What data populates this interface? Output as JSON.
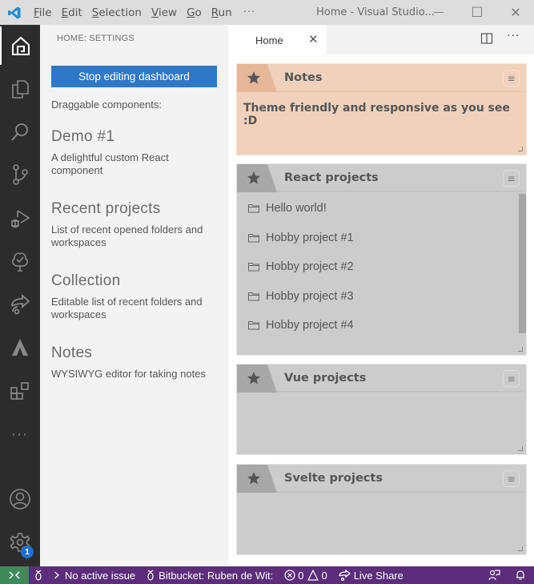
{
  "titlebar": {
    "menu": [
      {
        "accel": "F",
        "rest": "ile"
      },
      {
        "accel": "E",
        "rest": "dit"
      },
      {
        "accel": "S",
        "rest": "election"
      },
      {
        "accel": "V",
        "rest": "iew"
      },
      {
        "accel": "G",
        "rest": "o"
      },
      {
        "accel": "R",
        "rest": "un"
      }
    ],
    "more": "···",
    "window_title": "Home - Visual Studio...",
    "controls": {
      "minimize": "—",
      "maximize": "☐",
      "close": "✕"
    }
  },
  "activitybar": {
    "items": [
      "home-icon",
      "explorer-icon",
      "search-icon",
      "source-control-icon",
      "run-debug-icon",
      "tree-icon",
      "live-share-icon",
      "atlassian-icon",
      "extensions-icon",
      "more-icon",
      "account-icon",
      "settings-gear-icon"
    ],
    "more_label": "···",
    "settings_badge": "1"
  },
  "sidebar": {
    "title": "HOME: SETTINGS",
    "stop_button": "Stop editing dashboard",
    "draggable_label": "Draggable components:",
    "components": [
      {
        "title": "Demo #1",
        "description": "A delightful custom React component"
      },
      {
        "title": "Recent projects",
        "description": "List of recent opened folders and workspaces"
      },
      {
        "title": "Collection",
        "description": "Editable list of recent folders and workspaces"
      },
      {
        "title": "Notes",
        "description": "WYSIWYG editor for taking notes"
      }
    ]
  },
  "editor": {
    "tab_label": "Home",
    "tab_close": "✕",
    "more_actions": "···",
    "widgets": {
      "notes": {
        "title": "Notes",
        "content": "Theme friendly and responsive as you see :D",
        "color": "#f0d2bc"
      },
      "react": {
        "title": "React projects",
        "items": [
          "Hello world!",
          "Hobby project #1",
          "Hobby project #2",
          "Hobby project #3",
          "Hobby project #4"
        ]
      },
      "vue": {
        "title": "Vue projects"
      },
      "svelte": {
        "title": "Svelte projects"
      }
    },
    "menu_glyph": "≡"
  },
  "statusbar": {
    "no_issue": "No active issue",
    "bitbucket": "Bitbucket: Ruben de Wit:",
    "errors": "0",
    "warnings": "0",
    "live_share": "Live Share",
    "color": "#5c2d7a",
    "remote_color": "#3f8a5a"
  }
}
